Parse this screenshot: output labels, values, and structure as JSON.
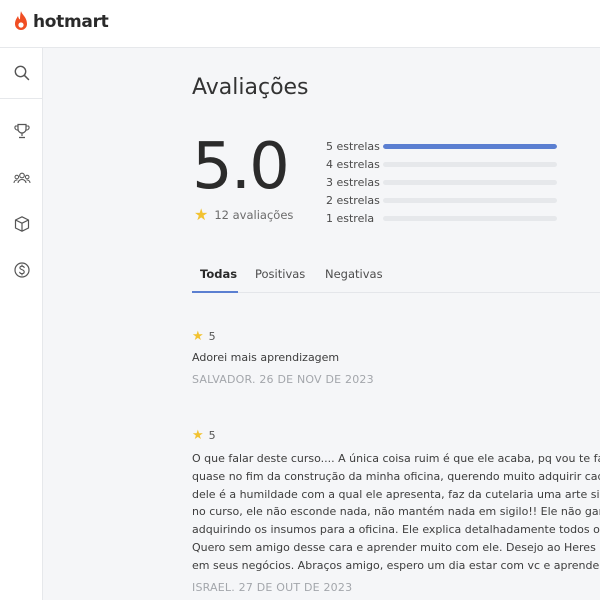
{
  "brand": {
    "name": "hotmart",
    "color": "#f04e23"
  },
  "sidebar": {
    "items": [
      {
        "name": "search",
        "icon": "search-icon"
      },
      {
        "name": "trophy",
        "icon": "trophy-icon"
      },
      {
        "name": "community",
        "icon": "users-icon"
      },
      {
        "name": "products",
        "icon": "box-icon"
      },
      {
        "name": "sales",
        "icon": "dollar-icon"
      }
    ]
  },
  "page": {
    "title": "Avaliações"
  },
  "summary": {
    "score": "5.0",
    "count_label": "12 avaliações",
    "bars": [
      {
        "label": "5 estrelas",
        "fraction": 1.0
      },
      {
        "label": "4 estrelas",
        "fraction": 0.0
      },
      {
        "label": "3 estrelas",
        "fraction": 0.0
      },
      {
        "label": "2 estrelas",
        "fraction": 0.0
      },
      {
        "label": "1 estrela",
        "fraction": 0.0
      }
    ]
  },
  "tabs": [
    {
      "label": "Todas",
      "active": true
    },
    {
      "label": "Positivas",
      "active": false
    },
    {
      "label": "Negativas",
      "active": false
    }
  ],
  "reviews": [
    {
      "rating": "5",
      "lines": [
        "Adorei mais aprendizagem"
      ],
      "meta": "SALVADOR. 26 DE NOV DE 2023"
    },
    {
      "rating": "5",
      "lines": [
        "O que falar deste curso.... A única coisa ruim é que ele acaba, pq vou te falar, escutar o",
        "quase no fim da construção da minha oficina, querendo muito adquirir cada item, cada",
        "dele é a humildade com a qual ele apresenta, faz da cutelaria uma arte simples e gost",
        "no curso, ele não esconde nada, não mantém nada em sigilo!! Ele não ganha nada com",
        "adquirindo os insumos para a oficina. Ele explica detalhadamente todos os passos par",
        "Quero sem amigo desse cara e aprender muito com ele. Desejo ao Heres muito suces",
        "em seus negócios. Abraços amigo, espero um dia estar com vc e aprender de perto to"
      ],
      "meta": "ISRAEL. 27 DE OUT DE 2023"
    }
  ]
}
